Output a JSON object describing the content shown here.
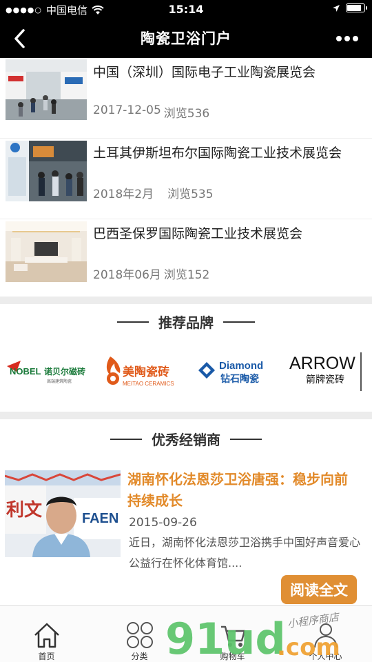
{
  "status": {
    "carrier": "中国电信",
    "time": "15:14",
    "battery_level": 0.85
  },
  "nav": {
    "title": "陶瓷卫浴门户",
    "back_icon": "chevron-left-icon",
    "more_icon": "more-dots-icon"
  },
  "news": [
    {
      "title": "中国（深圳）国际电子工业陶瓷展览会",
      "date": "2017-12-05",
      "views": "浏览536"
    },
    {
      "title": "土耳其伊斯坦布尔国际陶瓷工业技术展览会",
      "date": "2018年2月",
      "views": "浏览535"
    },
    {
      "title": "巴西圣保罗国际陶瓷工业技术展览会",
      "date": "2018年06月",
      "views": "浏览152"
    }
  ],
  "brands_section": {
    "heading": "推荐品牌",
    "brands": [
      {
        "name": "诺贝尔磁砖",
        "latin": "NOBEL",
        "sub": "高端建筑陶瓷",
        "color": "#1a7a3a"
      },
      {
        "name": "美陶瓷砖",
        "latin": "MEITAO CERAMICS",
        "color": "#e05a1a"
      },
      {
        "name": "钻石陶瓷",
        "latin": "Diamond",
        "color": "#1a5aa8"
      },
      {
        "name": "箭牌瓷砖",
        "latin": "ARROW",
        "color": "#111111"
      }
    ]
  },
  "dealers_section": {
    "heading": "优秀经销商",
    "dealer": {
      "title": "湖南怀化法恩莎卫浴唐强：稳步向前 持续成长",
      "date": "2015-09-26",
      "desc": "近日，湖南怀化法恩莎卫浴携手中国好声音爱心公益行在怀化体育馆....",
      "photo_text": "FAEN",
      "read_label": "阅读全文"
    }
  },
  "tabbar": [
    {
      "label": "首页",
      "icon": "home-icon"
    },
    {
      "label": "分类",
      "icon": "category-icon"
    },
    {
      "label": "购物车",
      "icon": "cart-icon"
    },
    {
      "label": "个人中心",
      "icon": "user-icon"
    }
  ],
  "watermark": {
    "text": "91ud",
    "suffix": ".com",
    "handwritten": "小程序商店"
  },
  "colors": {
    "accent": "#e08f34",
    "dealer_title": "#e28a2a",
    "nav_bg": "#000000"
  }
}
